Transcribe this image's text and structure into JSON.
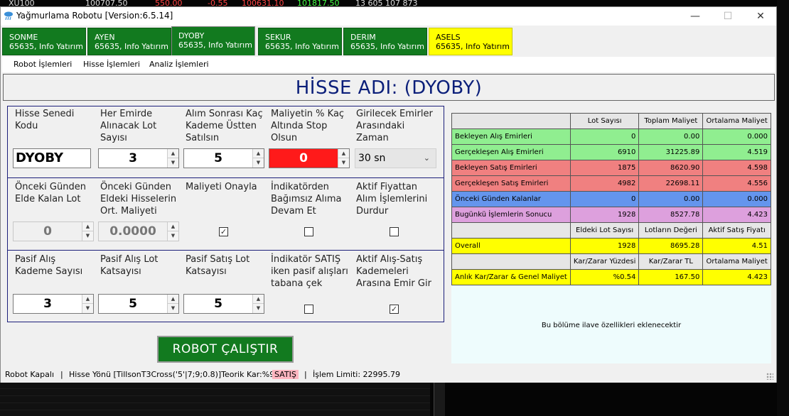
{
  "background": {
    "ticker": [
      "XU100",
      "100707.50",
      "550.00",
      "-0.55",
      "100631.10",
      "101817.50",
      "13 605 107 873"
    ]
  },
  "window": {
    "title": "Yağmurlama Robotu [Version:6.5.14]",
    "controls": {
      "minimize": "—",
      "maximize": "☐",
      "close": "✕"
    }
  },
  "tabs": [
    {
      "name": "SONME",
      "sub": "65635, Info Yatırım",
      "color": "green"
    },
    {
      "name": "AYEN",
      "sub": "65635, Info Yatırım",
      "color": "green"
    },
    {
      "name": "DYOBY",
      "sub": "65635, Info Yatırım",
      "color": "green",
      "active": true
    },
    {
      "name": "SEKUR",
      "sub": "65635, Info Yatırım",
      "color": "green"
    },
    {
      "name": "DERIM",
      "sub": "65635, Info Yatırım",
      "color": "green"
    },
    {
      "name": "ASELS",
      "sub": "65635, Info Yatırım",
      "color": "yellow"
    }
  ],
  "menu": [
    "Robot İşlemleri",
    "Hisse İşlemleri",
    "Analiz İşlemleri"
  ],
  "header": {
    "title": "HİSSE ADI: (DYOBY)"
  },
  "form1": {
    "stock_code_label": "Hisse Senedi\nKodu",
    "stock_code": "DYOBY",
    "lot_label": "Her Emirde\nAlınacak Lot\nSayısı",
    "lot_value": "3",
    "kademe_label": "Alım Sonrası Kaç\nKademe Üstten\nSatılsın",
    "kademe_value": "5",
    "stop_label": "Maliyetin % Kaç\nAltında Stop\nOlsun",
    "stop_value": "0",
    "interval_label": "Girilecek Emirler\nArasındaki\nZaman",
    "interval_value": "30 sn"
  },
  "form2": {
    "prev_lot_label": "Önceki Günden\nElde Kalan Lot",
    "prev_lot_value": "0",
    "prev_cost_label": "Önceki Günden\nEldeki Hisselerin\nOrt. Maliyeti",
    "prev_cost_value": "0.0000",
    "approve_cost_label": "Maliyeti Onayla",
    "approve_cost_checked": true,
    "indep_label": "İndikatörden\nBağımsız Alıma\nDevam Et",
    "indep_checked": false,
    "stop_buy_label": "Aktif Fiyattan\nAlım İşlemlerini\nDurdur",
    "stop_buy_checked": false
  },
  "form3": {
    "passive_buy_label": "Pasif Alış\nKademe Sayısı",
    "passive_buy_value": "3",
    "passive_lot_label": "Pasif Alış Lot\nKatsayısı",
    "passive_lot_value": "5",
    "passive_sell_label": "Pasif Satış Lot\nKatsayısı",
    "passive_sell_value": "5",
    "ind_sell_label": "İndikatör SATIŞ\niken pasif alışları\ntabana çek",
    "ind_sell_checked": false,
    "between_label": "Aktif Alış-Satış\nKademeleri\nArasına Emir Gir",
    "between_checked": true
  },
  "run_button": "ROBOT ÇALIŞTIR",
  "table": {
    "headers": [
      "",
      "Lot Sayısı",
      "Toplam Maliyet",
      "Ortalama Maliyet"
    ],
    "rows": [
      {
        "label": "Bekleyen Alış Emirleri",
        "c1": "0",
        "c2": "0.00",
        "c3": "0.000",
        "color": "#90ee90"
      },
      {
        "label": "Gerçekleşen Alış Emirleri",
        "c1": "6910",
        "c2": "31225.89",
        "c3": "4.519",
        "color": "#90ee90"
      },
      {
        "label": "Bekleyen Satış Emirleri",
        "c1": "1875",
        "c2": "8620.90",
        "c3": "4.598",
        "color": "#f08080"
      },
      {
        "label": "Gerçekleşen Satış Emirleri",
        "c1": "4982",
        "c2": "22698.11",
        "c3": "4.556",
        "color": "#f08080"
      },
      {
        "label": "Önceki Günden Kalanlar",
        "c1": "0",
        "c2": "0.00",
        "c3": "0.000",
        "color": "#6495ed"
      },
      {
        "label": "Bugünkü İşlemlerin Sonucu",
        "c1": "1928",
        "c2": "8527.78",
        "c3": "4.423",
        "color": "#dda0dd"
      }
    ],
    "headers2": [
      "",
      "Eldeki Lot Sayısı",
      "Lotların Değeri",
      "Aktif Satış Fiyatı"
    ],
    "overall": {
      "label": "Overall",
      "c1": "1928",
      "c2": "8695.28",
      "c3": "4.51",
      "color": "#ffff00"
    },
    "headers3": [
      "",
      "Kar/Zarar Yüzdesi",
      "Kar/Zarar TL",
      "Ortalama Maliyet"
    ],
    "instant": {
      "label": "Anlık Kar/Zarar & Genel Maliyet",
      "c1": "%0.54",
      "c2": "167.50",
      "c3": "4.423",
      "color": "#ffff00"
    }
  },
  "info_pane": "Bu bölüme ilave özellikleri eklenecektir",
  "status": {
    "robot": "Robot Kapalı",
    "sep": "|",
    "direction_label": "Hisse Yönü [TillsonT3Cross('5'|7;9;0.8)]Teorik Kar:%9] :",
    "direction_value": "SATIŞ",
    "limit": "İşlem Limiti:  22995.79"
  }
}
